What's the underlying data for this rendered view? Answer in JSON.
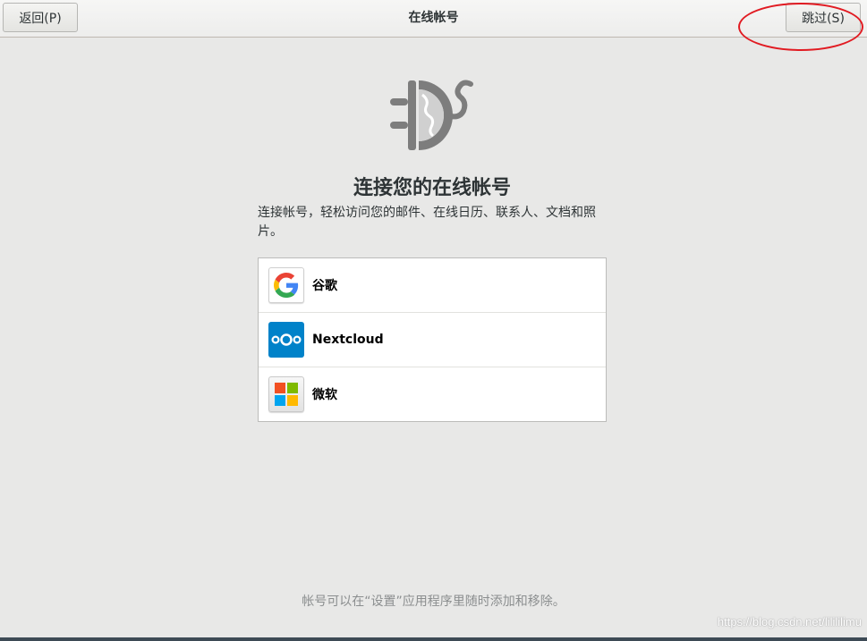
{
  "header": {
    "back_label": "返回(P)",
    "title": "在线帐号",
    "skip_label": "跳过(S)"
  },
  "main": {
    "title": "连接您的在线帐号",
    "description": "连接帐号，轻松访问您的邮件、在线日历、联系人、文档和照片。",
    "providers": [
      {
        "label": "谷歌",
        "icon": "google-icon"
      },
      {
        "label": "Nextcloud",
        "icon": "nextcloud-icon"
      },
      {
        "label": "微软",
        "icon": "microsoft-icon"
      }
    ]
  },
  "footer": {
    "hint": "帐号可以在“设置”应用程序里随时添加和移除。"
  },
  "watermark": "https://blog.csdn.net/lilililimu",
  "colors": {
    "annotation_circle": "#e11b22",
    "nextcloud_blue": "#0082c9",
    "background": "#e8e8e7"
  }
}
